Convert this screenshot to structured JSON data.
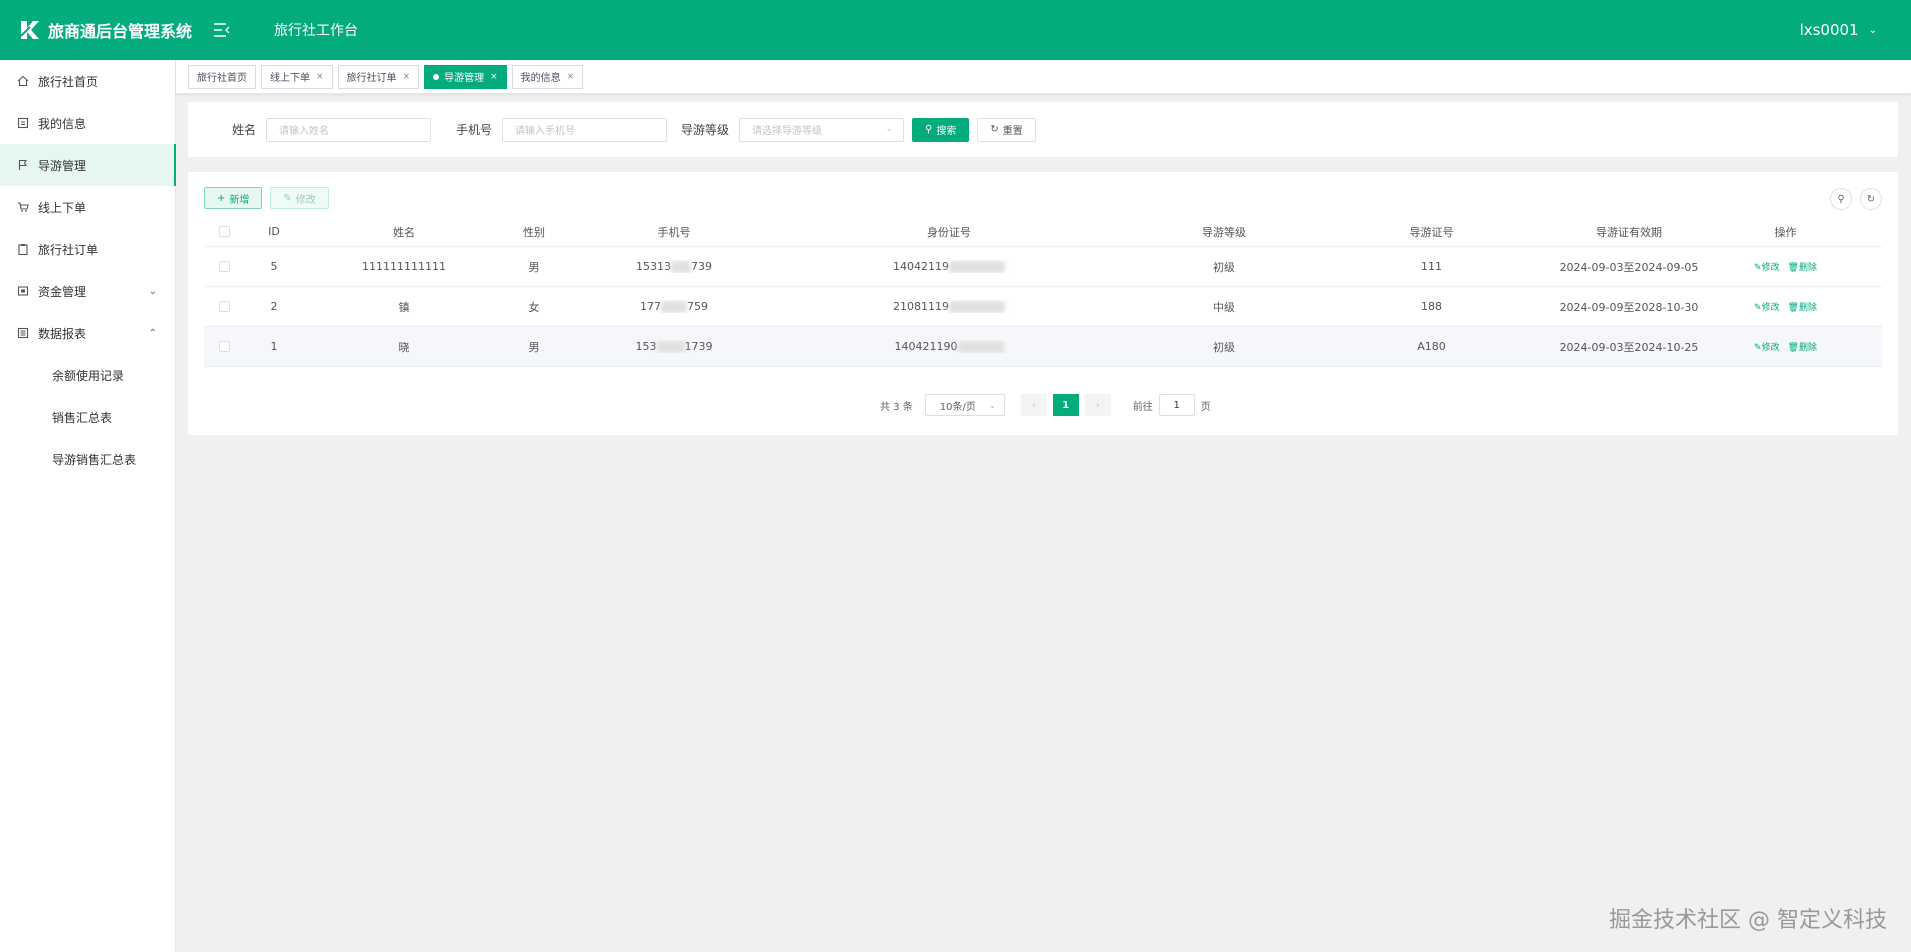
{
  "header": {
    "app_title": "旅商通后台管理系统",
    "workbench": "旅行社工作台",
    "username": "lxs0001",
    "brand_color": "#04ab7d"
  },
  "sidebar": {
    "items": [
      {
        "label": "旅行社首页",
        "icon": "home-icon"
      },
      {
        "label": "我的信息",
        "icon": "profile-icon"
      },
      {
        "label": "导游管理",
        "icon": "flag-icon",
        "active": true
      },
      {
        "label": "线上下单",
        "icon": "cart-icon"
      },
      {
        "label": "旅行社订单",
        "icon": "clipboard-icon"
      },
      {
        "label": "资金管理",
        "icon": "wallet-icon",
        "expandable": "collapsed"
      },
      {
        "label": "数据报表",
        "icon": "report-icon",
        "expandable": "expanded"
      }
    ],
    "subitems": [
      {
        "label": "余额使用记录"
      },
      {
        "label": "销售汇总表"
      },
      {
        "label": "导游销售汇总表"
      }
    ]
  },
  "tags": [
    {
      "label": "旅行社首页"
    },
    {
      "label": "线上下单"
    },
    {
      "label": "旅行社订单"
    },
    {
      "label": "导游管理",
      "active": true
    },
    {
      "label": "我的信息"
    }
  ],
  "search": {
    "name_label": "姓名",
    "name_placeholder": "请输入姓名",
    "phone_label": "手机号",
    "phone_placeholder": "请输入手机号",
    "level_label": "导游等级",
    "level_placeholder": "请选择导游等级",
    "search_button": "搜索",
    "reset_button": "重置"
  },
  "toolbar": {
    "add_button": "新增",
    "edit_button": "修改"
  },
  "table": {
    "columns": [
      "ID",
      "姓名",
      "性别",
      "手机号",
      "身份证号",
      "导游等级",
      "导游证号",
      "导游证有效期",
      "操作"
    ],
    "rows": [
      {
        "id": "5",
        "name": "111111111111",
        "sex": "男",
        "phone_a": "15313",
        "phone_b": "739",
        "idcard": "14042119",
        "level": "初级",
        "cert": "111",
        "valid": "2024-09-03至2024-09-05"
      },
      {
        "id": "2",
        "name": "镇",
        "sex": "女",
        "phone_a": "177",
        "phone_b": "759",
        "idcard": "21081119",
        "level": "中级",
        "cert": "188",
        "valid": "2024-09-09至2028-10-30"
      },
      {
        "id": "1",
        "name": "晓",
        "sex": "男",
        "phone_a": "153",
        "phone_b": "1739",
        "idcard": "140421190",
        "level": "初级",
        "cert": "A180",
        "valid": "2024-09-03至2024-10-25"
      }
    ],
    "op_edit": "修改",
    "op_delete": "删除"
  },
  "pagination": {
    "total": "共 3 条",
    "page_size": "10条/页",
    "current_page": "1",
    "goto_label": "前往",
    "goto_value": "1",
    "page_unit": "页"
  },
  "watermark": "掘金技术社区 @ 智定义科技"
}
